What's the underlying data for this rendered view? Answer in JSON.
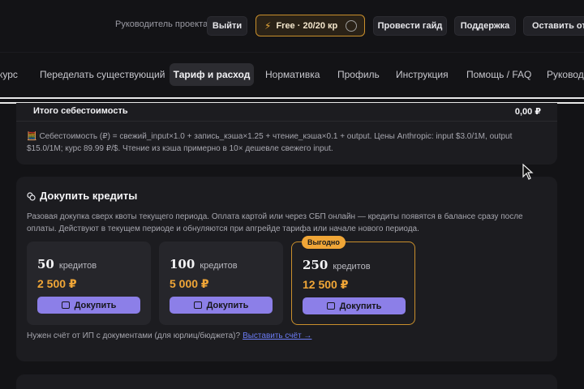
{
  "header": {
    "role": "Руководитель проекта",
    "logout": "Выйти",
    "plan": {
      "bolt": "⚡",
      "label": "Free · 20/20 кр"
    },
    "guide": "Провести гайд",
    "support": "Поддержка",
    "feedback": "Оставить отзыв"
  },
  "nav": {
    "items": [
      "курс",
      "Переделать существующий",
      "Тариф и расход",
      "Нормативка",
      "Профиль",
      "Инструкция",
      "Помощь / FAQ",
      "Руководство"
    ],
    "active_index": 2
  },
  "cost": {
    "total_label": "Итого себестоимость",
    "total_value": "0,00 ₽",
    "formula": "Себестоимость (₽) = свежий_input×1.0 + запись_кэша×1.25 + чтение_кэша×0.1 + output. Цены Anthropic: input $3.0/1M, output $15.0/1M; курс 89.99 ₽/$. Чтение из кэша примерно в 10× дешевле свежего input."
  },
  "buy": {
    "title": "Докупить кредиты",
    "description": "Разовая докупка сверх квоты текущего периода. Оплата картой или через СБП онлайн — кредиты появятся в балансе сразу после оплаты. Действуют в текущем периоде и обнуляются при апгрейде тарифа или начале нового периода.",
    "unit_label": "кредитов",
    "buy_label": "Докупить",
    "packages": [
      {
        "amount": "50",
        "price": "2 500 ₽"
      },
      {
        "amount": "100",
        "price": "5 000 ₽"
      },
      {
        "amount": "250",
        "price": "12 500 ₽",
        "badge": "Выгодно"
      }
    ],
    "invoice_text": "Нужен счёт от ИП с документами (для юрлиц/бюджета)?",
    "invoice_link": "Выставить счёт →"
  },
  "colors": {
    "accent": "#8c7fe8",
    "price": "#f0a637",
    "badge": "#f0a637",
    "plan_border": "#c98f2c",
    "link": "#6b7cf5"
  }
}
